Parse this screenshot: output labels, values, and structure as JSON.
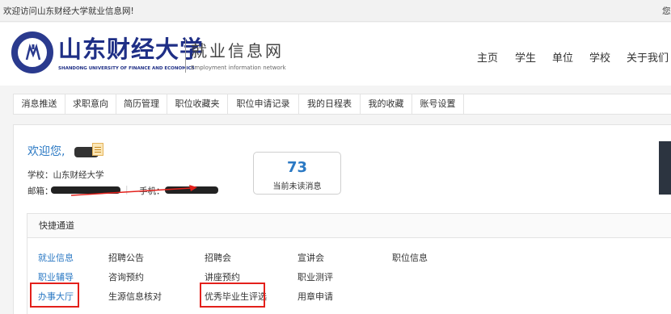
{
  "topbar": {
    "welcome": "欢迎访问山东财经大学就业信息网!",
    "right_text": "您"
  },
  "header": {
    "university_cn": "山东财经大学",
    "university_en": "SHANDONG UNIVERSITY OF FINANCE AND ECONOMICS",
    "site_cn": "就业信息网",
    "site_en": "Employment information network",
    "nav": [
      "主页",
      "学生",
      "单位",
      "学校",
      "关于我们"
    ]
  },
  "tabs": [
    "消息推送",
    "求职意向",
    "简历管理",
    "职位收藏夹",
    "职位申请记录",
    "我的日程表",
    "我的收藏",
    "账号设置"
  ],
  "profile": {
    "greeting": "欢迎您,",
    "school": "学校：山东财经大学",
    "email_label": "邮箱：",
    "separator": "|",
    "phone_label": "手机：",
    "unread_count": "73",
    "unread_label": "当前未读消息"
  },
  "quick": {
    "title": "快捷通道",
    "rows": [
      [
        "就业信息",
        "招聘公告",
        "招聘会",
        "宣讲会",
        "职位信息"
      ],
      [
        "职业辅导",
        "咨询预约",
        "讲座预约",
        "职业测评"
      ],
      [
        "办事大厅",
        "生源信息核对",
        "优秀毕业生评选",
        "用章申请"
      ]
    ]
  },
  "colors": {
    "brand": "#1f2f86",
    "link": "#2b79c4",
    "highlight": "#e3201b"
  }
}
